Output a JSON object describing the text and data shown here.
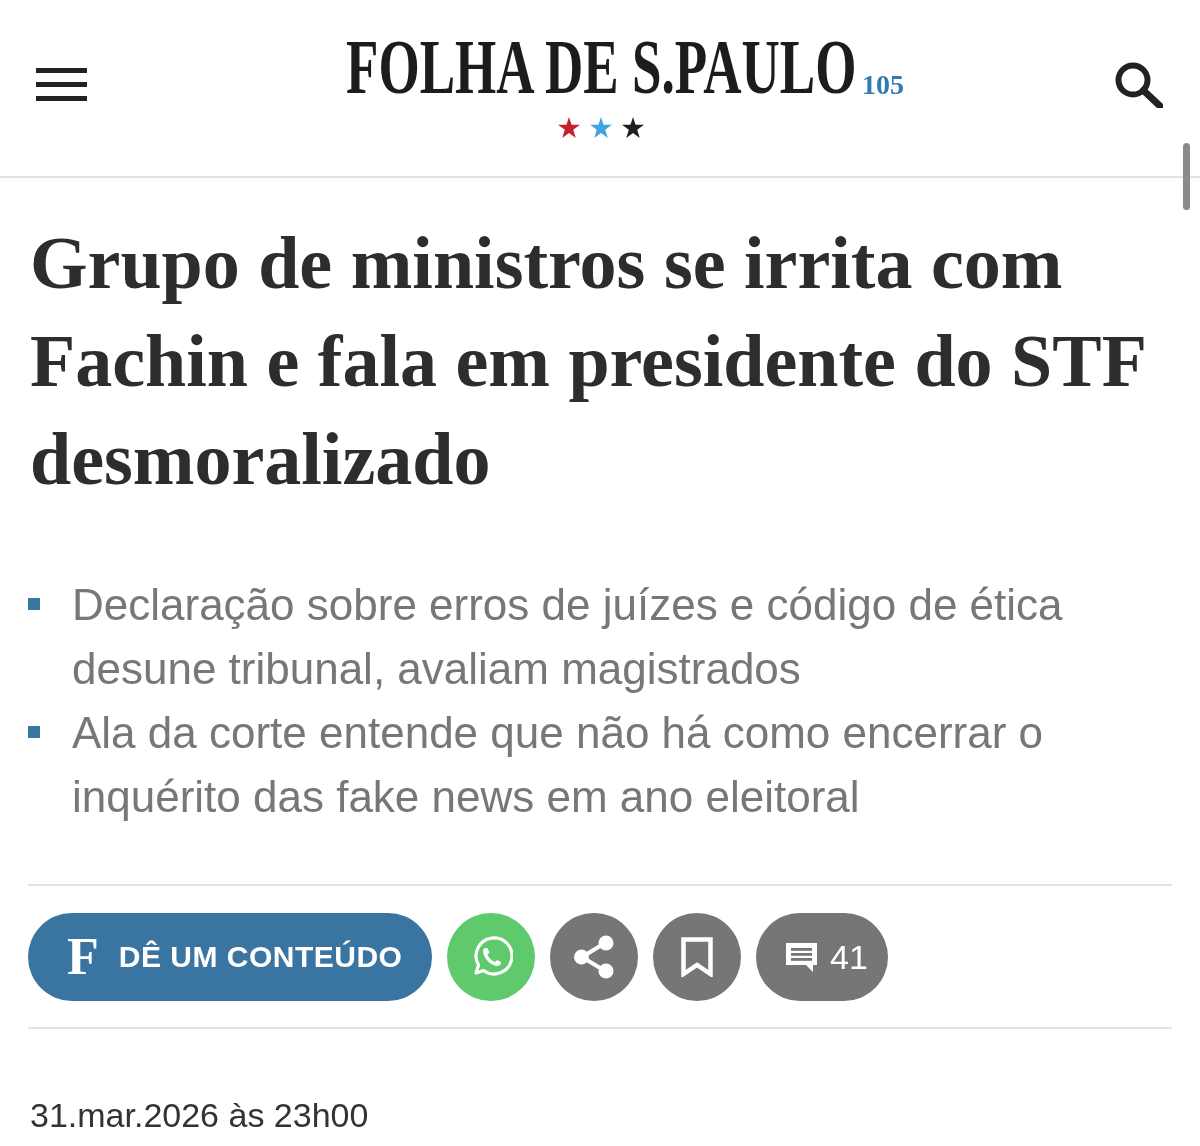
{
  "header": {
    "logo": "FOLHA DE S.PAULO",
    "logo_suffix": "105"
  },
  "headline": "Grupo de ministros se irrita com Fachin e fala em presidente do STF desmoralizado",
  "summary": [
    "Declaração sobre erros de juízes e código de ética desune tribunal, avaliam magistrados",
    "Ala da corte entende que não há como encerrar o inquérito das fake news em ano eleitoral"
  ],
  "actions": [
    {
      "kind": "contribute",
      "badge": "F",
      "label": "DÊ UM CONTEÚDO"
    },
    {
      "kind": "whatsapp"
    },
    {
      "kind": "share"
    },
    {
      "kind": "bookmark"
    },
    {
      "kind": "comments",
      "count": "41"
    }
  ],
  "date": "31.mar.2026 às 23h00"
}
